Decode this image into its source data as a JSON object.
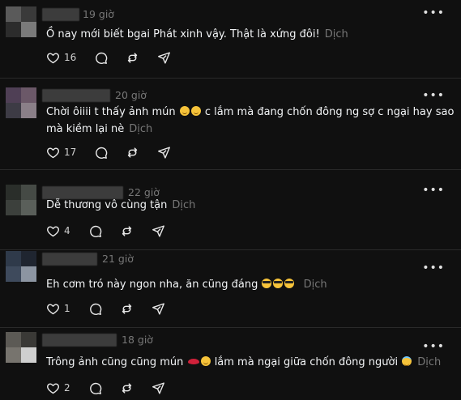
{
  "translate_label": "Dịch",
  "more_label": "•••",
  "comments": [
    {
      "time": "19 giờ",
      "line1_pre": "Ồ nay mới biết bgai Phát xinh vậy. Thật là xứng đôi!",
      "likes": "16",
      "avatar_colors": [
        "#5a5a5a",
        "#3a3a3a",
        "#2c2c2c",
        "#7a7a7a"
      ]
    },
    {
      "time": "20 giờ",
      "line1_pre": "Chời ôiiii t thấy ảnh mún",
      "line1_emoji": [
        "smirk",
        "smirk"
      ],
      "line1_post": "c lắm mà đang chốn đông ng sợ c ngại hay sao",
      "line2": "mà kiềm lại nè",
      "likes": "17",
      "avatar_colors": [
        "#4f3f55",
        "#6b5868",
        "#3d3b45",
        "#8a7f88"
      ]
    },
    {
      "time": "22 giờ",
      "line1_pre": "Dễ thương vô cùng tận",
      "likes": "4",
      "avatar_colors": [
        "#2a2e2a",
        "#454a45",
        "#3c403c",
        "#5a5f5a"
      ]
    },
    {
      "time": "21 giờ",
      "line1_pre": "Eh cơm tró này ngon nha, ăn cũng đáng",
      "line1_emoji": [
        "cool",
        "cool",
        "cool"
      ],
      "likes": "1",
      "avatar_colors": [
        "#2f3a4a",
        "#1f2530",
        "#3e4a5c",
        "#8c95a2"
      ]
    },
    {
      "time": "18 giờ",
      "line1_pre": "Trông ảnh cũng cũng mún",
      "line1_emoji": [
        "lips",
        "smirk"
      ],
      "line1_post": "lắm mà ngại giữa chốn đông người",
      "line1_emoji2": [
        "innocent"
      ],
      "likes": "2",
      "avatar_colors": [
        "#5c5a55",
        "#3a3936",
        "#77746e",
        "#cfcfcf"
      ]
    }
  ]
}
